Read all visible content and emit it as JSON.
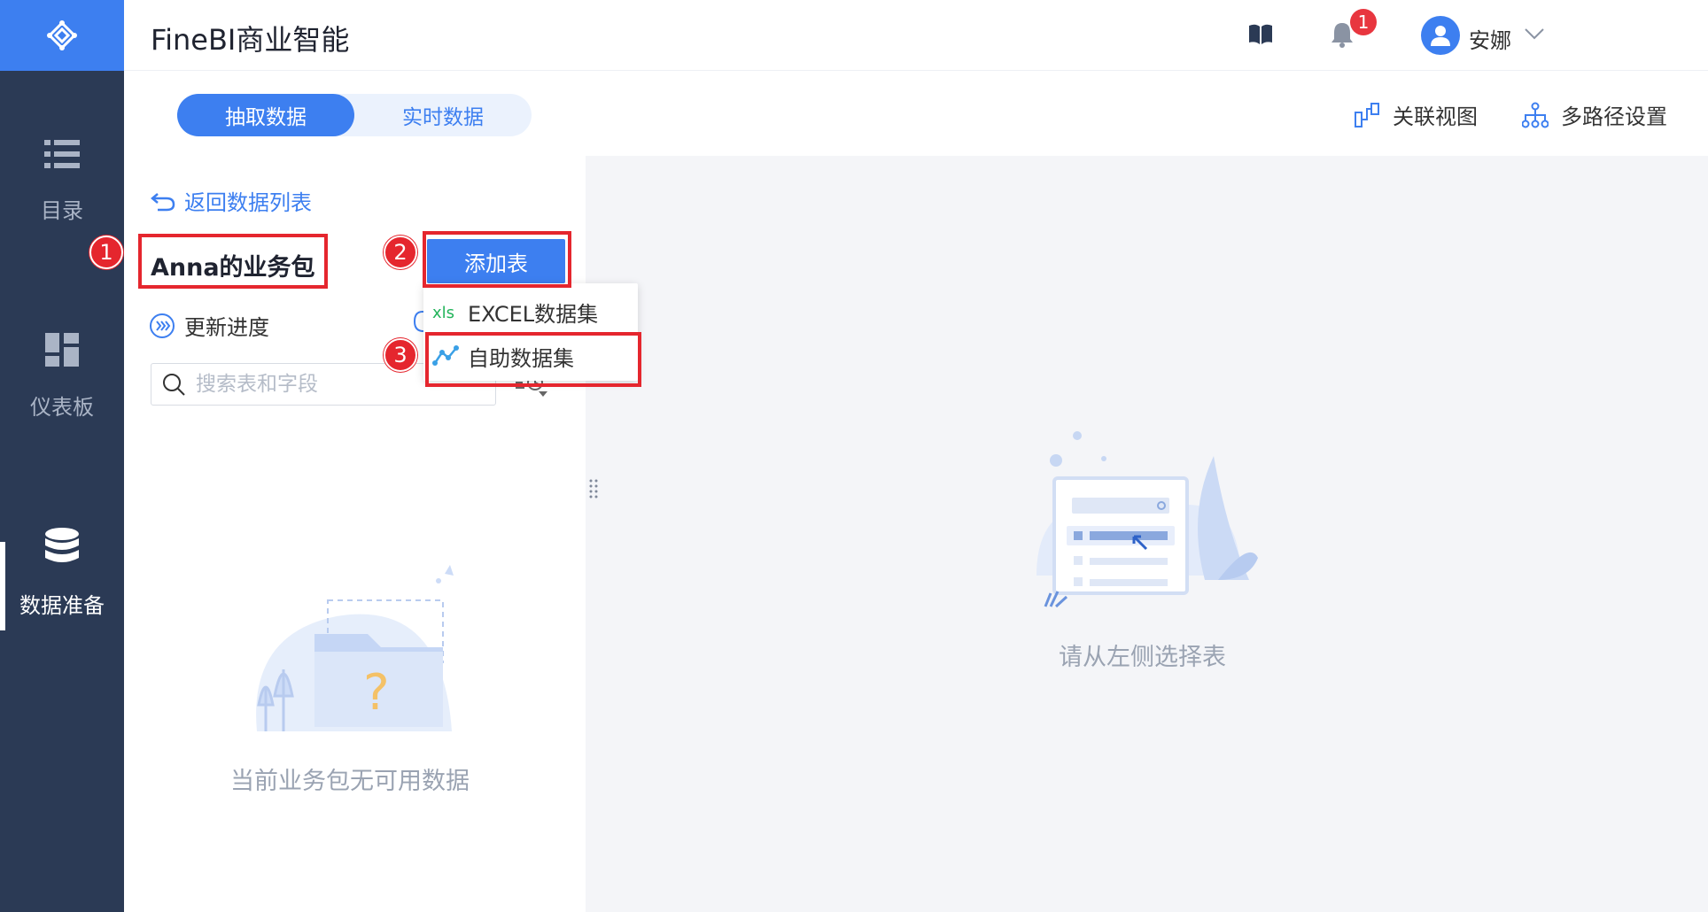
{
  "app": {
    "title": "FineBI商业智能"
  },
  "header": {
    "notification_count": "1",
    "user_name": "安娜"
  },
  "sidebar": {
    "items": [
      {
        "label": "目录",
        "icon": "list-icon"
      },
      {
        "label": "仪表板",
        "icon": "dashboard-icon"
      },
      {
        "label": "数据准备",
        "icon": "database-icon",
        "active": true
      }
    ]
  },
  "toolbar": {
    "tabs": [
      {
        "label": "抽取数据",
        "active": true
      },
      {
        "label": "实时数据",
        "active": false
      }
    ],
    "relation_view": "关联视图",
    "multipath_setting": "多路径设置"
  },
  "left_panel": {
    "back_link": "返回数据列表",
    "package_title": "Anna的业务包",
    "add_table": "添加表",
    "update_progress": "更新进度",
    "search_placeholder": "搜索表和字段",
    "empty_text": "当前业务包无可用数据"
  },
  "dropdown": {
    "items": [
      {
        "label": "EXCEL数据集",
        "icon": "xls-icon"
      },
      {
        "label": "自助数据集",
        "icon": "self-service-dataset-icon"
      }
    ]
  },
  "right_panel": {
    "empty_text": "请从左侧选择表"
  },
  "annotations": [
    "1",
    "2",
    "3"
  ],
  "colors": {
    "accent": "#3d7ff0",
    "sidebar": "#2b3a55",
    "annotation": "#e5262e"
  }
}
